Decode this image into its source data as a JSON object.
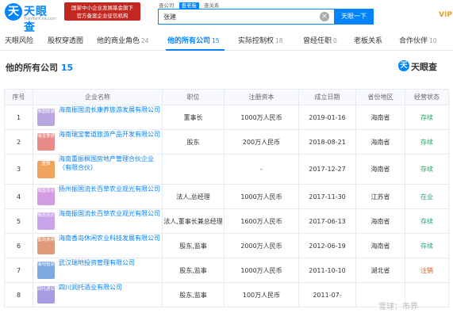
{
  "header": {
    "logo_text": "天眼查",
    "logo_url": "TianYanCha.com",
    "slogan_line1": "国家中小企业发展基金旗下",
    "slogan_line2": "官方备案企业征信机构",
    "search_tabs": [
      "查公司",
      "查老板",
      "查关系"
    ],
    "search_value": "张建",
    "search_button": "天眼一下",
    "vip": "VIP"
  },
  "tabs": [
    {
      "label": "天眼风险",
      "count": ""
    },
    {
      "label": "股权穿透图",
      "count": ""
    },
    {
      "label": "他的商业角色",
      "count": "24"
    },
    {
      "label": "他的所有公司",
      "count": "15"
    },
    {
      "label": "实际控制权",
      "count": "18"
    },
    {
      "label": "曾经任职",
      "count": "0"
    },
    {
      "label": "老板关系",
      "count": ""
    },
    {
      "label": "合作伙伴",
      "count": "10"
    }
  ],
  "section": {
    "title": "他的所有公司",
    "count": "15",
    "brand": "天眼查"
  },
  "columns": [
    "序号",
    "企业名称",
    "职位",
    "注册资本",
    "成立日期",
    "省份地区",
    "经营状态"
  ],
  "rows": [
    {
      "no": "1",
      "logo": "振国旅游",
      "logo_color": "#b9a8e0",
      "name": "海南振国流长康养旅游发展有限公司",
      "position": "董事长",
      "capital": "1000万人民币",
      "date": "2019-01-16",
      "region": "海南省",
      "status": "存续",
      "status_class": "st-green"
    },
    {
      "no": "2",
      "logo": "瑞宝奢侈",
      "logo_color": "#e98a8a",
      "name": "海南瑞宝奢道旅游产品开发有限公司",
      "position": "股东",
      "capital": "200万人民币",
      "date": "2018-08-21",
      "region": "海南省",
      "status": "存续",
      "status_class": "st-green"
    },
    {
      "no": "3",
      "logo": "重振",
      "logo_color": "#f0a35e",
      "name": "海南重振枫国房地产管理合伙企业（有限合伙）",
      "position": "",
      "capital": "-",
      "date": "2017-12-27",
      "region": "海南省",
      "status": "存续",
      "status_class": "st-green"
    },
    {
      "no": "4",
      "logo": "振国流长",
      "logo_color": "#d39be0",
      "name": "扬州振国流长百草农业观光有限公司",
      "position": "法人,总经理",
      "capital": "1000万人民币",
      "date": "2017-11-30",
      "region": "江苏省",
      "status": "在业",
      "status_class": "st-green"
    },
    {
      "no": "5",
      "logo": "振国流长",
      "logo_color": "#c7a3e8",
      "name": "海南振国流长百草农业观光有限公司",
      "position": "法人,董事长兼总经理",
      "capital": "1600万人民币",
      "date": "2017-06-13",
      "region": "海南省",
      "status": "存续",
      "status_class": "st-green"
    },
    {
      "no": "6",
      "logo": "香岛休闲",
      "logo_color": "#e09a7a",
      "name": "海南香岛休闲农业科技发展有限公司",
      "position": "股东,监事",
      "capital": "2000万人民币",
      "date": "2012-06-19",
      "region": "海南省",
      "status": "存续",
      "status_class": "st-green"
    },
    {
      "no": "7",
      "logo": "瑞地投资",
      "logo_color": "#7fa8e0",
      "name": "武汉瑞地投资管理有限公司",
      "position": "股东,监事",
      "capital": "1000万人民币",
      "date": "2011-10-10",
      "region": "湖北省",
      "status": "注销",
      "status_class": "st-red"
    },
    {
      "no": "8",
      "logo": "润托酒业",
      "logo_color": "#a89ce0",
      "name": "四川润托酒业有限公司",
      "position": "股东,监事",
      "capital": "100万人民币",
      "date": "2011-07-",
      "region": "",
      "status": "",
      "status_class": "st-green"
    }
  ],
  "watermark": "雪球：市界"
}
